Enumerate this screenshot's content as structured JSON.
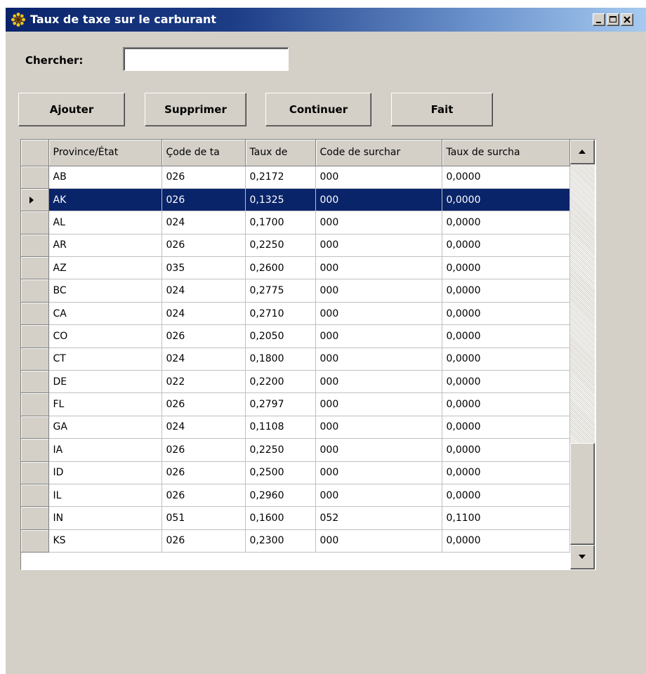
{
  "window": {
    "title": "Taux de taxe sur le carburant",
    "app_icon": "sunflower-icon"
  },
  "search": {
    "label": "Chercher:",
    "value": ""
  },
  "buttons": {
    "add": "Ajouter",
    "delete": "Supprimer",
    "continue": "Continuer",
    "done": "Fait"
  },
  "grid": {
    "columns": [
      "Province/État",
      "Çode de ta",
      "Taux de",
      "Code de surchar",
      "Taux de surcha"
    ],
    "selected_row": 1,
    "rows": [
      [
        "AB",
        "026",
        "0,2172",
        "000",
        "0,0000"
      ],
      [
        "AK",
        "026",
        "0,1325",
        "000",
        "0,0000"
      ],
      [
        "AL",
        "024",
        "0,1700",
        "000",
        "0,0000"
      ],
      [
        "AR",
        "026",
        "0,2250",
        "000",
        "0,0000"
      ],
      [
        "AZ",
        "035",
        "0,2600",
        "000",
        "0,0000"
      ],
      [
        "BC",
        "024",
        "0,2775",
        "000",
        "0,0000"
      ],
      [
        "CA",
        "024",
        "0,2710",
        "000",
        "0,0000"
      ],
      [
        "CO",
        "026",
        "0,2050",
        "000",
        "0,0000"
      ],
      [
        "CT",
        "024",
        "0,1800",
        "000",
        "0,0000"
      ],
      [
        "DE",
        "022",
        "0,2200",
        "000",
        "0,0000"
      ],
      [
        "FL",
        "026",
        "0,2797",
        "000",
        "0,0000"
      ],
      [
        "GA",
        "024",
        "0,1108",
        "000",
        "0,0000"
      ],
      [
        "IA",
        "026",
        "0,2250",
        "000",
        "0,0000"
      ],
      [
        "ID",
        "026",
        "0,2500",
        "000",
        "0,0000"
      ],
      [
        "IL",
        "026",
        "0,2960",
        "000",
        "0,0000"
      ],
      [
        "IN",
        "051",
        "0,1600",
        "052",
        "0,1100"
      ],
      [
        "KS",
        "026",
        "0,2300",
        "000",
        "0,0000"
      ]
    ]
  },
  "colors": {
    "selection": "#0a246a",
    "face": "#d4d0c8"
  }
}
